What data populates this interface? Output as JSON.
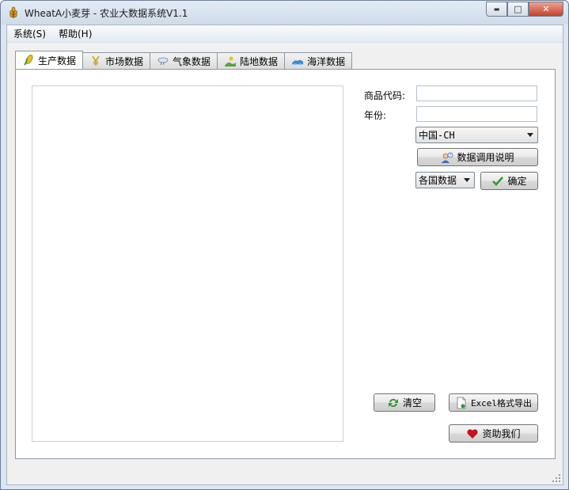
{
  "window": {
    "title": "WheatA小麦芽 - 农业大数据系统V1.1",
    "minimize_glyph": "▬",
    "maximize_glyph": "□",
    "close_glyph": "✕",
    "app_icon": "wheat-icon"
  },
  "menu": {
    "items": [
      "系统(S)",
      "帮助(H)"
    ]
  },
  "tabs": [
    {
      "label": "生产数据",
      "icon": "corn-icon",
      "active": true
    },
    {
      "label": "市场数据",
      "icon": "yuan-icon",
      "active": false
    },
    {
      "label": "气象数据",
      "icon": "cloud-icon",
      "active": false
    },
    {
      "label": "陆地数据",
      "icon": "land-icon",
      "active": false
    },
    {
      "label": "海洋数据",
      "icon": "ocean-icon",
      "active": false
    }
  ],
  "form": {
    "product_code_label": "商品代码:",
    "product_code_value": "",
    "year_label": "年份:",
    "year_value": "",
    "country_selected": "中国-CH",
    "data_help_button": "数据调用说明",
    "scope_selected": "各国数据",
    "confirm_button": "确定"
  },
  "actions": {
    "clear_button": "清空",
    "export_button": "Excel格式导出",
    "donate_button": "资助我们"
  },
  "colors": {
    "accent_green": "#2e9a2e",
    "heart_red": "#c0141e"
  }
}
